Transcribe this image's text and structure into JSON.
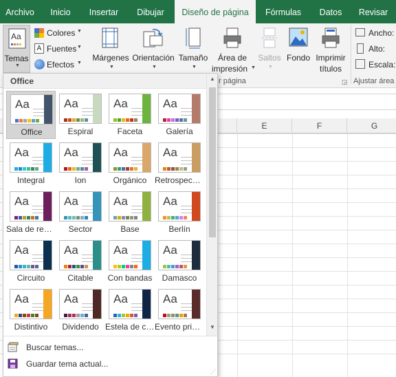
{
  "tabs": [
    {
      "label": "Archivo",
      "active": false
    },
    {
      "label": "Inicio",
      "active": false
    },
    {
      "label": "Insertar",
      "active": false
    },
    {
      "label": "Dibujar",
      "active": false
    },
    {
      "label": "Diseño de página",
      "active": true
    },
    {
      "label": "Fórmulas",
      "active": false
    },
    {
      "label": "Datos",
      "active": false
    },
    {
      "label": "Revisar",
      "active": false
    }
  ],
  "ribbon": {
    "themes_label": "Temas",
    "colors_label": "Colores",
    "fonts_label": "Fuentes",
    "effects_label": "Efectos",
    "margins_label": "Márgenes",
    "orientation_label": "Orientación",
    "size_label": "Tamaño",
    "print_area_label_1": "Área de",
    "print_area_label_2": "impresión",
    "breaks_label": "Saltos",
    "background_label": "Fondo",
    "print_titles_label_1": "Imprimir",
    "print_titles_label_2": "títulos",
    "page_setup_group": "r página",
    "width_label": "Ancho:",
    "height_label": "Alto:",
    "scale_label": "Escala:",
    "scale_group": "Ajustar área"
  },
  "columns": [
    "E",
    "F",
    "G"
  ],
  "gallery": {
    "header": "Office",
    "themes": [
      {
        "name": "Office",
        "accent": "#44546a",
        "swatches": [
          "#4472c4",
          "#ed7d31",
          "#a5a5a5",
          "#ffc000",
          "#5b9bd5",
          "#70ad47"
        ],
        "selected": true
      },
      {
        "name": "Espiral",
        "accent": "#c7dac0",
        "swatches": [
          "#9e3611",
          "#c24c20",
          "#e2a62c",
          "#6b8e4e",
          "#95b97a",
          "#5f8fa6"
        ],
        "selected": false
      },
      {
        "name": "Faceta",
        "accent": "#6cb33f",
        "swatches": [
          "#90c226",
          "#54a021",
          "#e6b91e",
          "#e76618",
          "#c42f1a",
          "#918655"
        ],
        "selected": false
      },
      {
        "name": "Galería",
        "accent": "#b57b6a",
        "swatches": [
          "#b71e42",
          "#de478e",
          "#bc72f0",
          "#795faf",
          "#586ea6",
          "#6892a0"
        ],
        "selected": false
      },
      {
        "name": "Integral",
        "accent": "#1cade4",
        "swatches": [
          "#1cade4",
          "#2683c6",
          "#27ced7",
          "#42ba97",
          "#3e8853",
          "#62a39f"
        ],
        "selected": false
      },
      {
        "name": "Ion",
        "accent": "#1e5155",
        "swatches": [
          "#b01513",
          "#ea6312",
          "#e6b729",
          "#6aac90",
          "#54849a",
          "#9e5e9b"
        ],
        "selected": false
      },
      {
        "name": "Orgánico",
        "accent": "#d9a76b",
        "swatches": [
          "#83992a",
          "#3c9770",
          "#44709d",
          "#a23c33",
          "#d97828",
          "#deb340"
        ],
        "selected": false
      },
      {
        "name": "Retrospección",
        "accent": "#ca9d63",
        "swatches": [
          "#e48312",
          "#bd582c",
          "#865640",
          "#9b8357",
          "#c2bc80",
          "#94a088"
        ],
        "selected": false
      },
      {
        "name": "Sala de reuniones",
        "accent": "#6d1e5d",
        "swatches": [
          "#7c1f7c",
          "#42589f",
          "#b5a12e",
          "#2e8b57",
          "#ca6d2e",
          "#3c7a9c"
        ],
        "selected": false
      },
      {
        "name": "Sector",
        "accent": "#3494ba",
        "swatches": [
          "#3494ba",
          "#58b6c0",
          "#75bda7",
          "#7a8c8e",
          "#84acb6",
          "#2683c6"
        ],
        "selected": false
      },
      {
        "name": "Base",
        "accent": "#8fb140",
        "swatches": [
          "#6ea0b0",
          "#ccaf0a",
          "#8d89a4",
          "#748560",
          "#9e9273",
          "#7e848d"
        ],
        "selected": false
      },
      {
        "name": "Berlín",
        "accent": "#d0491f",
        "swatches": [
          "#f09415",
          "#c1b56b",
          "#4baf73",
          "#5aa6c0",
          "#d17df9",
          "#fa7e5c"
        ],
        "selected": false
      },
      {
        "name": "Circuito",
        "accent": "#0b2f4f",
        "swatches": [
          "#1c5aa6",
          "#2d8fd0",
          "#38b5c7",
          "#5cbfa5",
          "#7d4f8c",
          "#4f6b9e"
        ],
        "selected": false
      },
      {
        "name": "Citable",
        "accent": "#2a8e8a",
        "swatches": [
          "#f07f09",
          "#9f2936",
          "#1b587c",
          "#4e8542",
          "#604878",
          "#c19859"
        ],
        "selected": false
      },
      {
        "name": "Con bandas",
        "accent": "#1cade4",
        "swatches": [
          "#ffc000",
          "#a5d028",
          "#08cc78",
          "#f24099",
          "#828288",
          "#f56617"
        ],
        "selected": false
      },
      {
        "name": "Damasco",
        "accent": "#1d2d3d",
        "swatches": [
          "#9ec544",
          "#50bea3",
          "#4a9ccc",
          "#9a66ca",
          "#c54f71",
          "#de9c3c"
        ],
        "selected": false
      },
      {
        "name": "Distintivo",
        "accent": "#f5a623",
        "swatches": [
          "#f5a623",
          "#2e4a7d",
          "#8b4513",
          "#c04040",
          "#4a7d2e",
          "#7d4a2e"
        ],
        "selected": false
      },
      {
        "name": "Dividendo",
        "accent": "#4f2a24",
        "swatches": [
          "#4d1434",
          "#903163",
          "#b2324b",
          "#969fa7",
          "#66b1ce",
          "#40619d"
        ],
        "selected": false
      },
      {
        "name": "Estela de condensación",
        "accent": "#0f2447",
        "swatches": [
          "#1b6ab0",
          "#4aa5d8",
          "#99cc33",
          "#f2a900",
          "#d9533d",
          "#7a5ea8"
        ],
        "selected": false
      },
      {
        "name": "Evento principal",
        "accent": "#5a2b2b",
        "swatches": [
          "#b80e0f",
          "#a6987d",
          "#7f9a71",
          "#64908a",
          "#e8a202",
          "#a77a4b"
        ],
        "selected": false
      }
    ],
    "menu": {
      "browse": "Buscar temas...",
      "save": "Guardar tema actual..."
    }
  },
  "icons": {
    "themes": "themes-icon",
    "colors": "colors-icon",
    "fonts": "fonts-icon",
    "effects": "effects-icon",
    "margins": "margins-icon",
    "orientation": "orientation-icon",
    "size": "size-icon",
    "print_area": "print-area-icon",
    "breaks": "breaks-icon",
    "background": "background-icon",
    "print_titles": "print-titles-icon",
    "browse": "browse-themes-icon",
    "save": "save-theme-icon"
  },
  "colors": {
    "excel_green": "#217346",
    "ribbon_bg": "#f3f3f3"
  }
}
